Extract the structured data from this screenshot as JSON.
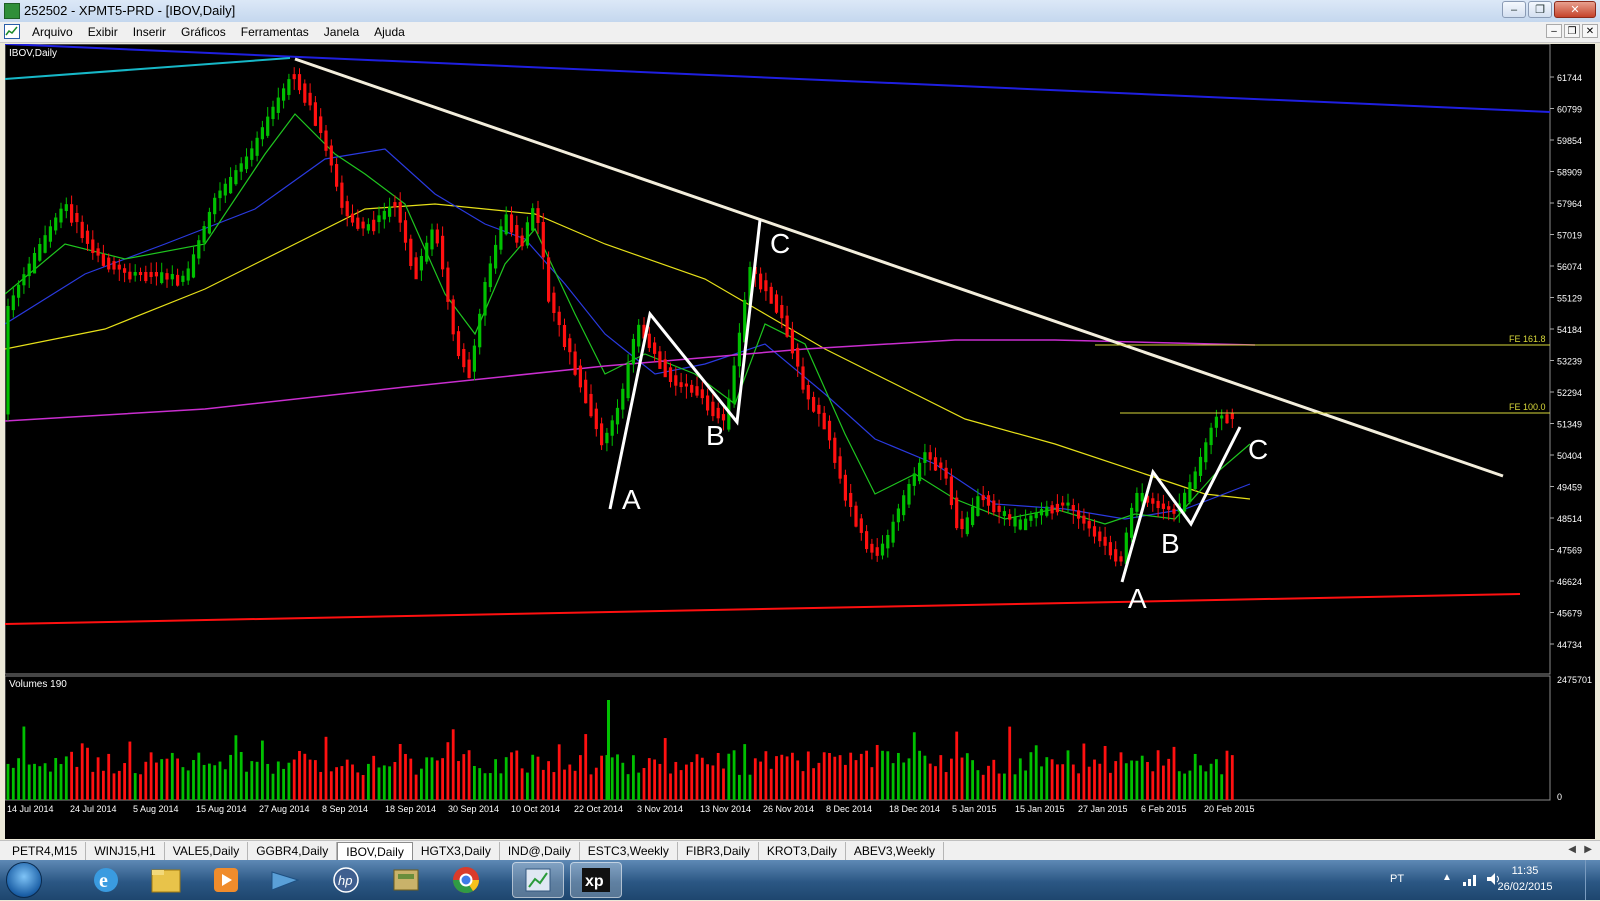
{
  "window": {
    "title": "252502 - XPMT5-PRD - [IBOV,Daily]"
  },
  "menu": [
    "Arquivo",
    "Exibir",
    "Inserir",
    "Gráficos",
    "Ferramentas",
    "Janela",
    "Ajuda"
  ],
  "chart": {
    "symbol_label": "IBOV,Daily",
    "volume_label": "Volumes 190",
    "price_axis": [
      "61744",
      "60799",
      "59854",
      "58909",
      "57964",
      "57019",
      "56074",
      "55129",
      "54184",
      "53239",
      "52294",
      "51349",
      "50404",
      "49459",
      "48514",
      "47569",
      "46624",
      "45679",
      "44734"
    ],
    "volume_axis": [
      "2475701",
      "0"
    ],
    "date_axis": [
      "14 Jul 2014",
      "24 Jul 2014",
      "5 Aug 2014",
      "15 Aug 2014",
      "27 Aug 2014",
      "8 Sep 2014",
      "18 Sep 2014",
      "30 Sep 2014",
      "10 Oct 2014",
      "22 Oct 2014",
      "3 Nov 2014",
      "13 Nov 2014",
      "26 Nov 2014",
      "8 Dec 2014",
      "18 Dec 2014",
      "5 Jan 2015",
      "15 Jan 2015",
      "27 Jan 2015",
      "6 Feb 2015",
      "20 Feb 2015"
    ],
    "fibo_labels": [
      "FE 161.8",
      "FE 100.0"
    ],
    "wave_labels": [
      "A",
      "B",
      "C",
      "A",
      "B",
      "C"
    ],
    "colors": {
      "bull": "#00c000",
      "bear": "#ff1010",
      "background": "#000000",
      "trendline": "#ffffff"
    }
  },
  "tabs": [
    {
      "label": "PETR4,M15"
    },
    {
      "label": "WINJ15,H1"
    },
    {
      "label": "VALE5,Daily"
    },
    {
      "label": "GGBR4,Daily"
    },
    {
      "label": "IBOV,Daily",
      "active": true
    },
    {
      "label": "HGTX3,Daily"
    },
    {
      "label": "IND@,Daily"
    },
    {
      "label": "ESTC3,Weekly"
    },
    {
      "label": "FIBR3,Daily"
    },
    {
      "label": "KROT3,Daily"
    },
    {
      "label": "ABEV3,Weekly"
    }
  ],
  "taskbar": {
    "apps": [
      "start",
      "internet-explorer",
      "file-explorer",
      "media-player",
      "network-app",
      "hp-app",
      "archive-app",
      "chrome",
      "metatrader",
      "xp-investimentos"
    ],
    "xp_label": "xp",
    "language": "PT",
    "time": "11:35",
    "date": "26/02/2015"
  }
}
